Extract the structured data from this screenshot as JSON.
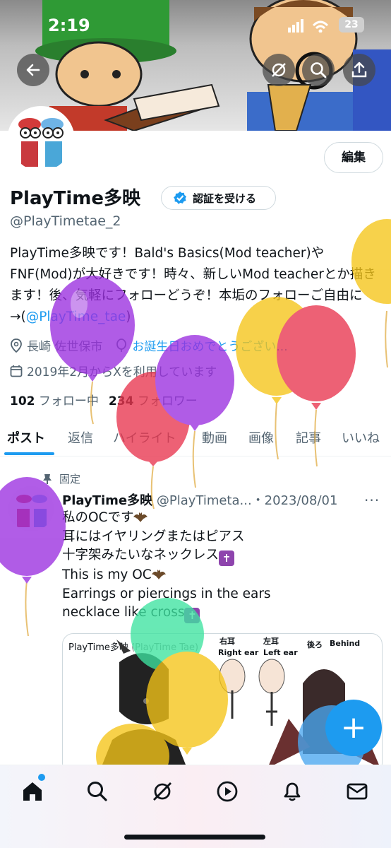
{
  "status_bar": {
    "time": "2:19",
    "battery": "23"
  },
  "profile": {
    "display_name": "PlayTime多映",
    "handle": "@PlayTimetae_2",
    "edit_label": "編集",
    "verify_label": "認証を受ける",
    "bio_text": "PlayTime多映です！Bald's Basics(Mod teacher)やFNF(Mod)が大好きです！時々、新しいMod teacherとか描きます！後、気軽にフォローどうぞ！本垢のフォローご自由に→(",
    "bio_link": "@PlayTime_tae",
    "bio_end": ")",
    "location": "長崎 佐世保市",
    "birthday_text": "お誕生日おめでとうござい...",
    "joined": "2019年2月からXを利用しています",
    "following_count": "102",
    "following_label": "フォロー中",
    "followers_count": "234",
    "followers_label": "フォロワー"
  },
  "tabs": [
    "ポスト",
    "返信",
    "ハイライト",
    "動画",
    "画像",
    "記事",
    "いいね"
  ],
  "post": {
    "pinned_label": "固定",
    "author": "PlayTime多映",
    "handle_date": "@PlayTimeta...・2023/08/01",
    "more": "···",
    "lines": [
      "私のOCです",
      "耳にはイヤリングまたはピアス",
      "十字架みたいなネックレス",
      "This is my OC",
      "Earrings or piercings in the ears",
      "necklace like cross"
    ],
    "image_caption": "PlayTime多映",
    "image_caption_sub": "(PlayTime Tae)",
    "image_labels": {
      "right_ear_jp": "右耳",
      "right_ear_en": "Right ear",
      "left_ear_jp": "左耳",
      "left_ear_en": "Left ear",
      "behind_jp": "後ろ",
      "behind_en": "Behind"
    }
  },
  "fab_label": "+",
  "bottom_nav": [
    "home-icon",
    "search-icon",
    "grok-icon",
    "video-icon",
    "notifications-icon",
    "messages-icon"
  ],
  "colors": {
    "accent": "#1d9bf0",
    "text": "#0f1419",
    "muted": "#536471"
  }
}
